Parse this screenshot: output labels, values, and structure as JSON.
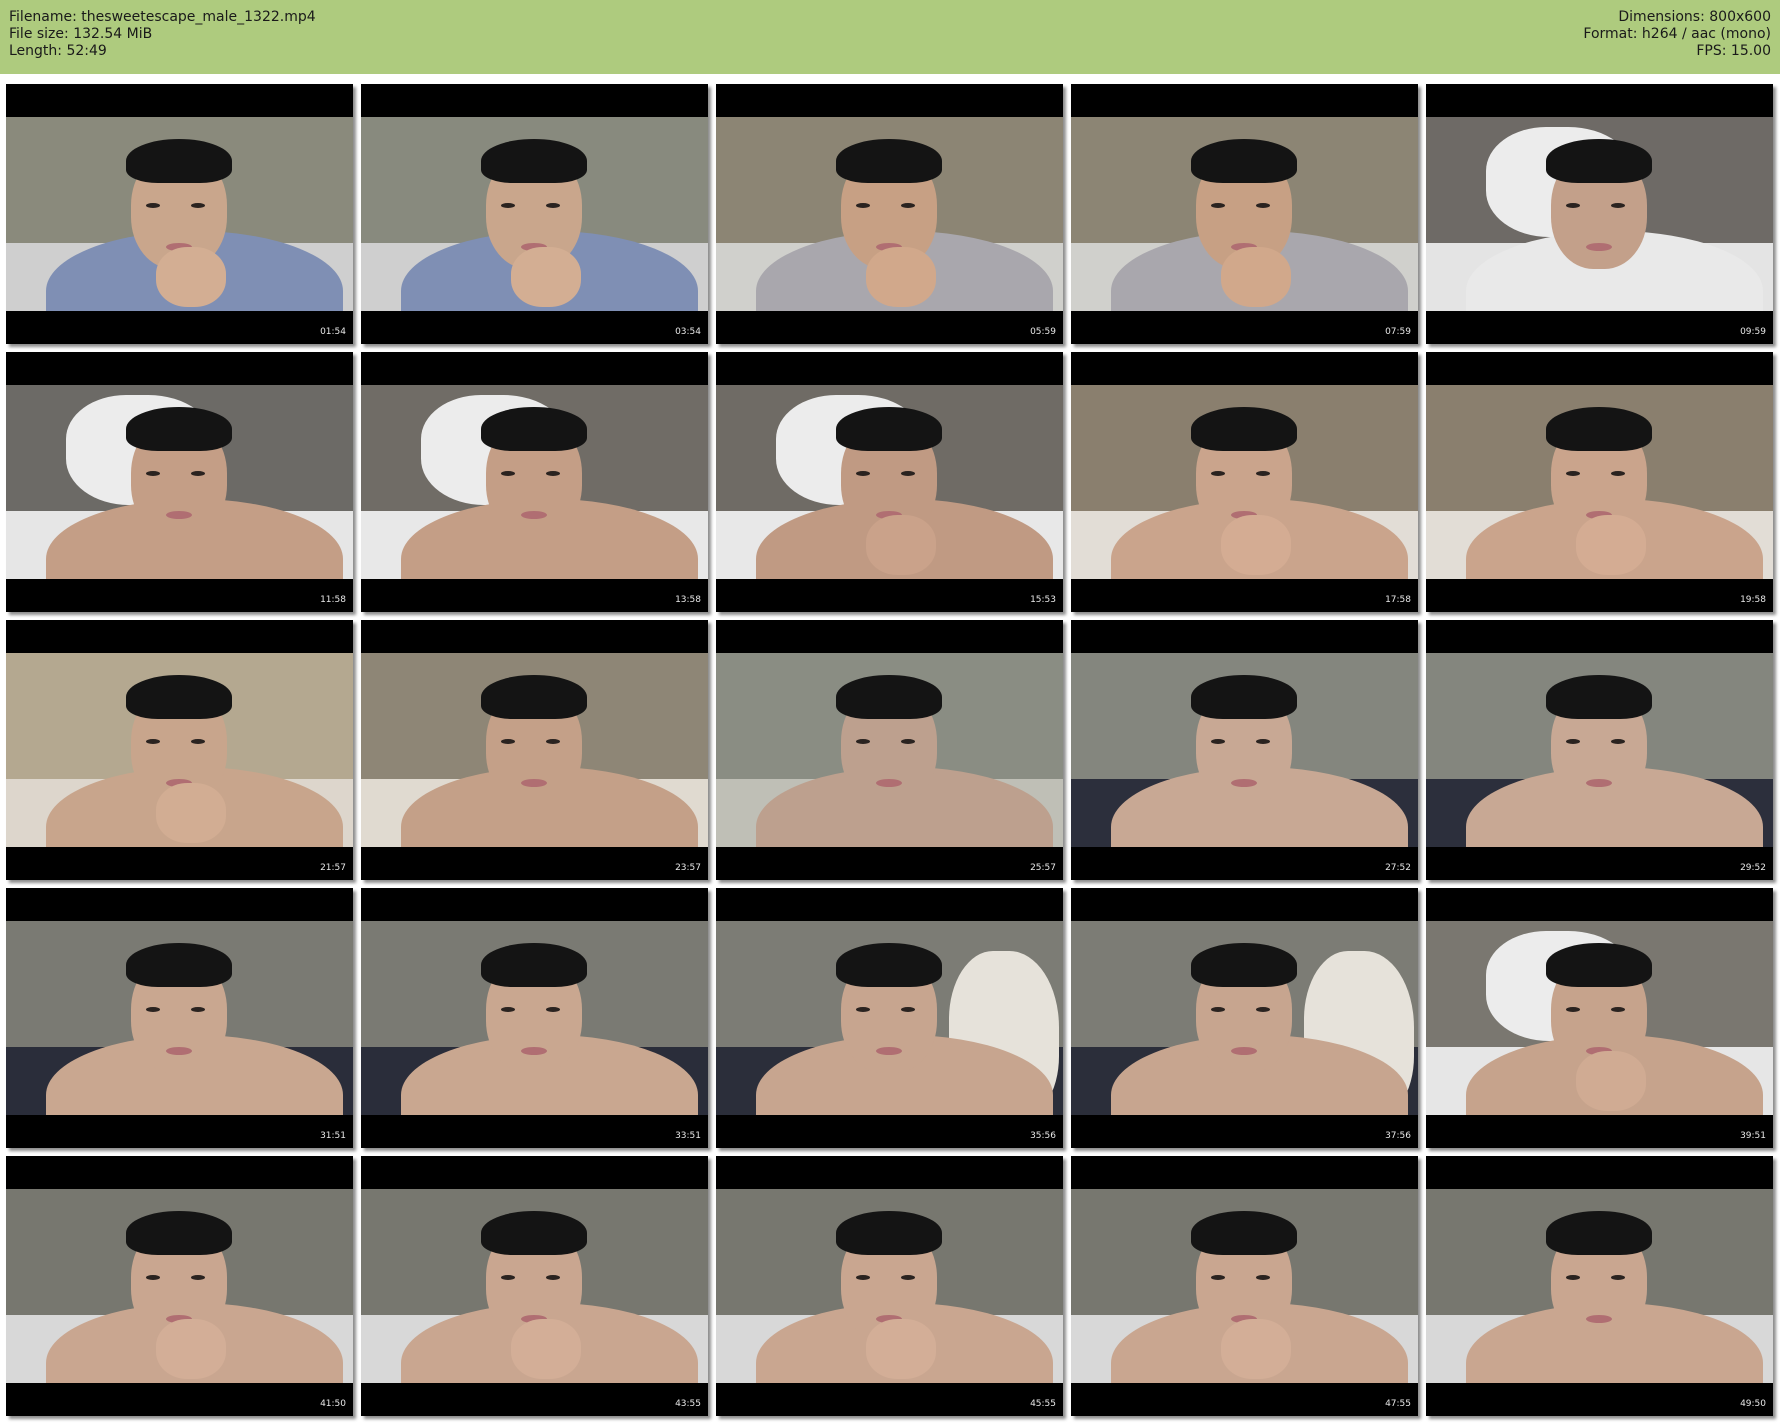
{
  "header": {
    "filename": "Filename: thesweetescape_male_1322.mp4",
    "filesize": "File size: 132.54 MiB",
    "length": "Length: 52:49",
    "dimensions": "Dimensions: 800x600",
    "format": "Format: h264 / aac (mono)",
    "fps": "FPS: 15.00"
  },
  "colors": {
    "header_bg": "#aecb7e",
    "page_bg": "#ffffff",
    "letterbox": "#000000"
  },
  "thumbnails": [
    {
      "timestamp": "01:54",
      "wall": "#8a8a7c",
      "bed": "#cfcfcf",
      "body": "#7f8fb4",
      "skin": "#c9a68c",
      "scene": "clothed",
      "hand": true
    },
    {
      "timestamp": "03:54",
      "wall": "#888a7e",
      "bed": "#cfcfcf",
      "body": "#7f8fb4",
      "skin": "#c9a68c",
      "scene": "clothed",
      "hand": true
    },
    {
      "timestamp": "05:59",
      "wall": "#8c8574",
      "bed": "#d0d0cc",
      "body": "#a9a7ad",
      "skin": "#c7a084",
      "scene": "clothed",
      "hand": true
    },
    {
      "timestamp": "07:59",
      "wall": "#8c8574",
      "bed": "#d0d0cc",
      "body": "#a9a7ad",
      "skin": "#c7a084",
      "scene": "clothed",
      "hand": true
    },
    {
      "timestamp": "09:59",
      "wall": "#6e6a66",
      "bed": "#e4e4e4",
      "body": "#e9e9e9",
      "skin": "#c3a08a",
      "scene": "pillow",
      "hand": false
    },
    {
      "timestamp": "11:58",
      "wall": "#6c6a66",
      "bed": "#e6e6e6",
      "body": "#c49e86",
      "skin": "#c49e86",
      "scene": "pillow",
      "hand": false
    },
    {
      "timestamp": "13:58",
      "wall": "#706c66",
      "bed": "#e8e8e8",
      "body": "#c49e86",
      "skin": "#c49e86",
      "scene": "pillow",
      "hand": false
    },
    {
      "timestamp": "15:53",
      "wall": "#6f6b65",
      "bed": "#e8e8e8",
      "body": "#c09a83",
      "skin": "#c09a83",
      "scene": "pillow",
      "hand": true
    },
    {
      "timestamp": "17:58",
      "wall": "#8a7f6e",
      "bed": "#e2ddd6",
      "body": "#caa48c",
      "skin": "#caa48c",
      "scene": "bare",
      "hand": true
    },
    {
      "timestamp": "19:58",
      "wall": "#8a7f6e",
      "bed": "#e2ddd6",
      "body": "#caa48c",
      "skin": "#caa48c",
      "scene": "bare",
      "hand": true
    },
    {
      "timestamp": "21:57",
      "wall": "#b4a890",
      "bed": "#ddd6cc",
      "body": "#c8a58c",
      "skin": "#c8a58c",
      "scene": "bare",
      "hand": true
    },
    {
      "timestamp": "23:57",
      "wall": "#8e8676",
      "bed": "#e0dad0",
      "body": "#c4a088",
      "skin": "#c4a088",
      "scene": "bare",
      "hand": false
    },
    {
      "timestamp": "25:57",
      "wall": "#8a8d83",
      "bed": "#bfbfb6",
      "body": "#bda08e",
      "skin": "#bda08e",
      "scene": "bare",
      "hand": false
    },
    {
      "timestamp": "27:52",
      "wall": "#84867e",
      "bed": "#2c2f3c",
      "body": "#c8a894",
      "skin": "#c8a894",
      "scene": "bare",
      "hand": false
    },
    {
      "timestamp": "29:52",
      "wall": "#84867e",
      "bed": "#2c2f3c",
      "body": "#c8a894",
      "skin": "#c8a894",
      "scene": "bare",
      "hand": false
    },
    {
      "timestamp": "31:51",
      "wall": "#7a7a73",
      "bed": "#2a2d3a",
      "body": "#c9a790",
      "skin": "#c9a790",
      "scene": "bare",
      "hand": false
    },
    {
      "timestamp": "33:51",
      "wall": "#7a7a73",
      "bed": "#2a2d3a",
      "body": "#c9a790",
      "skin": "#c9a790",
      "scene": "bare",
      "hand": false
    },
    {
      "timestamp": "35:56",
      "wall": "#7c7c75",
      "bed": "#2b2e3a",
      "body": "#c7a58f",
      "skin": "#c7a58f",
      "scene": "towel",
      "hand": false
    },
    {
      "timestamp": "37:56",
      "wall": "#7c7c75",
      "bed": "#2b2e3a",
      "body": "#c7a58f",
      "skin": "#c7a58f",
      "scene": "towel",
      "hand": false
    },
    {
      "timestamp": "39:51",
      "wall": "#7a7770",
      "bed": "#e6e6e6",
      "body": "#c6a38c",
      "skin": "#c6a38c",
      "scene": "pillow",
      "hand": true
    },
    {
      "timestamp": "41:50",
      "wall": "#77776f",
      "bed": "#d8d8d8",
      "body": "#c9a690",
      "skin": "#c9a690",
      "scene": "bare",
      "hand": true
    },
    {
      "timestamp": "43:55",
      "wall": "#77776f",
      "bed": "#d8d8d8",
      "body": "#c9a690",
      "skin": "#c9a690",
      "scene": "bare",
      "hand": true
    },
    {
      "timestamp": "45:55",
      "wall": "#77776f",
      "bed": "#d8d8d8",
      "body": "#c9a690",
      "skin": "#c9a690",
      "scene": "bare",
      "hand": true
    },
    {
      "timestamp": "47:55",
      "wall": "#77776f",
      "bed": "#d8d8d8",
      "body": "#c9a690",
      "skin": "#c9a690",
      "scene": "bare",
      "hand": true
    },
    {
      "timestamp": "49:50",
      "wall": "#77776f",
      "bed": "#d8d8d8",
      "body": "#c9a690",
      "skin": "#c9a690",
      "scene": "bare",
      "hand": false
    }
  ]
}
